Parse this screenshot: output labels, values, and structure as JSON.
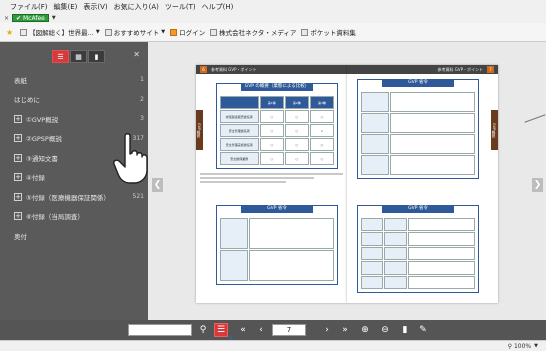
{
  "browser": {
    "menu": [
      "ファイル(F)",
      "編集(E)",
      "表示(V)",
      "お気に入り(A)",
      "ツール(T)",
      "ヘルプ(H)"
    ],
    "mcafee_label": "McAfee",
    "favorites": [
      {
        "label": "【図解総く】世界最...",
        "icon": "page-icon"
      },
      {
        "label": "おすすめサイト",
        "icon": "page-icon"
      },
      {
        "label": "ログイン",
        "icon": "orange-page-icon"
      },
      {
        "label": "株式会社ネクタ・メディア",
        "icon": "page-icon"
      },
      {
        "label": "ポケット資料集",
        "icon": "page-icon"
      }
    ],
    "zoom": "100%"
  },
  "sidebar": {
    "tabs": [
      "list",
      "grid",
      "bookmark"
    ],
    "items": [
      {
        "label": "表紙",
        "num": "1",
        "expand": false
      },
      {
        "label": "はじめに",
        "num": "2",
        "expand": false
      },
      {
        "label": "①GVP概説",
        "num": "3",
        "expand": true
      },
      {
        "label": "②GPSP概説",
        "num": "317",
        "expand": true
      },
      {
        "label": "③通知文書",
        "num": "421",
        "expand": true
      },
      {
        "label": "④付録",
        "num": "453",
        "expand": true
      },
      {
        "label": "⑤付録（医療機器保証関係）",
        "num": "521",
        "expand": true
      },
      {
        "label": "⑥付録（当局調査）",
        "num": "",
        "expand": true
      },
      {
        "label": "奥付",
        "num": "",
        "expand": false
      }
    ]
  },
  "document": {
    "left_page": {
      "number": "6",
      "header": "参考資料 GVP・ポイント",
      "side_tab": "GVP概説",
      "box1_title": "GVP の概要（業態による比較）",
      "box2_title": "GVP 省令",
      "col_headers": [
        "第1種",
        "第2種",
        "第3種"
      ],
      "row_labels": [
        "総括製造販売責任者",
        "安全管理責任者",
        "安全管理実施責任者",
        "安全確保業務"
      ],
      "cells": [
        "○",
        "○",
        "○",
        "○",
        "○",
        "×",
        "○",
        "○",
        "○",
        "○",
        "○",
        "○"
      ]
    },
    "right_page": {
      "number": "7",
      "header": "参考資料 GVP・ポイント",
      "side_tab": "GVP概説",
      "box1_title": "GVP 省令",
      "box2_title": "GVP 省令"
    }
  },
  "toolbar": {
    "page_value": "7",
    "buttons": [
      "search-icon",
      "toc-icon",
      "first-page-icon",
      "prev-page-icon",
      "next-page-icon",
      "last-page-icon",
      "zoom-in-icon",
      "zoom-out-icon",
      "bookmark-icon",
      "pen-icon"
    ]
  }
}
